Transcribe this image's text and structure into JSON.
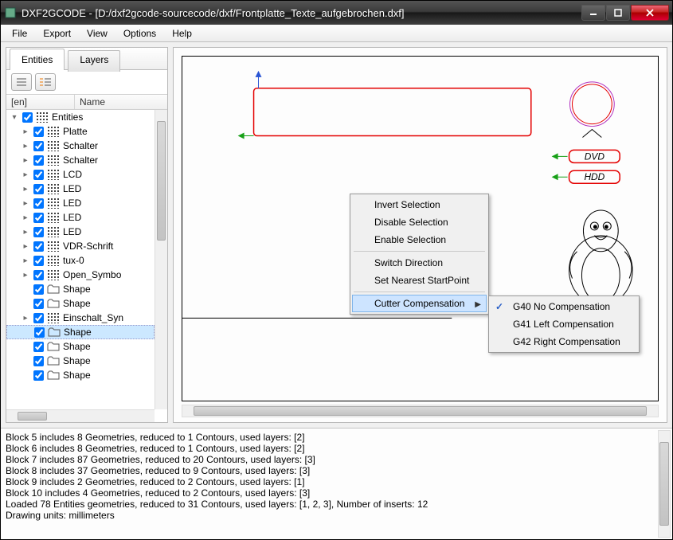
{
  "window": {
    "title": "DXF2GCODE - [D:/dxf2gcode-sourcecode/dxf/Frontplatte_Texte_aufgebrochen.dxf]"
  },
  "menu": {
    "items": [
      "File",
      "Export",
      "View",
      "Options",
      "Help"
    ]
  },
  "sidebar": {
    "tabs": [
      {
        "label": "Entities"
      },
      {
        "label": "Layers"
      }
    ],
    "active_tab": 0,
    "header": {
      "col1": "[en]",
      "col2": "Name"
    },
    "tree": [
      {
        "indent": 0,
        "expander": "▾",
        "checked": true,
        "icon": "grid",
        "label": "Entities"
      },
      {
        "indent": 1,
        "expander": "▸",
        "checked": true,
        "icon": "grid",
        "label": "Platte"
      },
      {
        "indent": 1,
        "expander": "▸",
        "checked": true,
        "icon": "grid",
        "label": "Schalter"
      },
      {
        "indent": 1,
        "expander": "▸",
        "checked": true,
        "icon": "grid",
        "label": "Schalter"
      },
      {
        "indent": 1,
        "expander": "▸",
        "checked": true,
        "icon": "grid",
        "label": "LCD"
      },
      {
        "indent": 1,
        "expander": "▸",
        "checked": true,
        "icon": "grid",
        "label": "LED"
      },
      {
        "indent": 1,
        "expander": "▸",
        "checked": true,
        "icon": "grid",
        "label": "LED"
      },
      {
        "indent": 1,
        "expander": "▸",
        "checked": true,
        "icon": "grid",
        "label": "LED"
      },
      {
        "indent": 1,
        "expander": "▸",
        "checked": true,
        "icon": "grid",
        "label": "LED"
      },
      {
        "indent": 1,
        "expander": "▸",
        "checked": true,
        "icon": "grid",
        "label": "VDR-Schrift"
      },
      {
        "indent": 1,
        "expander": "▸",
        "checked": true,
        "icon": "grid",
        "label": "tux-0"
      },
      {
        "indent": 1,
        "expander": "▸",
        "checked": true,
        "icon": "grid",
        "label": "Open_Symbo"
      },
      {
        "indent": 1,
        "expander": "",
        "checked": true,
        "icon": "folder",
        "label": "Shape"
      },
      {
        "indent": 1,
        "expander": "",
        "checked": true,
        "icon": "folder",
        "label": "Shape"
      },
      {
        "indent": 1,
        "expander": "▸",
        "checked": true,
        "icon": "grid",
        "label": "Einschalt_Syn"
      },
      {
        "indent": 1,
        "expander": "",
        "checked": true,
        "icon": "folder",
        "label": "Shape",
        "selected": true
      },
      {
        "indent": 1,
        "expander": "",
        "checked": true,
        "icon": "folder",
        "label": "Shape"
      },
      {
        "indent": 1,
        "expander": "",
        "checked": true,
        "icon": "folder",
        "label": "Shape"
      },
      {
        "indent": 1,
        "expander": "",
        "checked": true,
        "icon": "folder",
        "label": "Shape"
      }
    ]
  },
  "canvas": {
    "labels": {
      "dvd": "DVD",
      "hdd": "HDD"
    }
  },
  "context_menu": {
    "items": [
      {
        "label": "Invert Selection"
      },
      {
        "label": "Disable Selection"
      },
      {
        "label": "Enable Selection"
      },
      {
        "type": "sep"
      },
      {
        "label": "Switch Direction"
      },
      {
        "label": "Set Nearest StartPoint"
      },
      {
        "type": "sep"
      },
      {
        "label": "Cutter Compensation",
        "submenu": true,
        "hover": true
      }
    ],
    "submenu": [
      {
        "label": "G40 No Compensation",
        "checked": true
      },
      {
        "label": "G41 Left Compensation"
      },
      {
        "label": "G42 Right Compensation"
      }
    ]
  },
  "log": [
    "Block 5 includes 8 Geometries, reduced to 1 Contours, used layers: [2]",
    "Block 6 includes 8 Geometries, reduced to 1 Contours, used layers: [2]",
    "Block 7 includes 87 Geometries, reduced to 20 Contours, used layers: [3]",
    "Block 8 includes 37 Geometries, reduced to 9 Contours, used layers: [3]",
    "Block 9 includes 2 Geometries, reduced to 2 Contours, used layers: [1]",
    "Block 10 includes 4 Geometries, reduced to 2 Contours, used layers: [3]",
    "Loaded 78 Entities geometries, reduced to 31 Contours, used layers: [1, 2, 3], Number of inserts: 12",
    "Drawing units: millimeters"
  ]
}
